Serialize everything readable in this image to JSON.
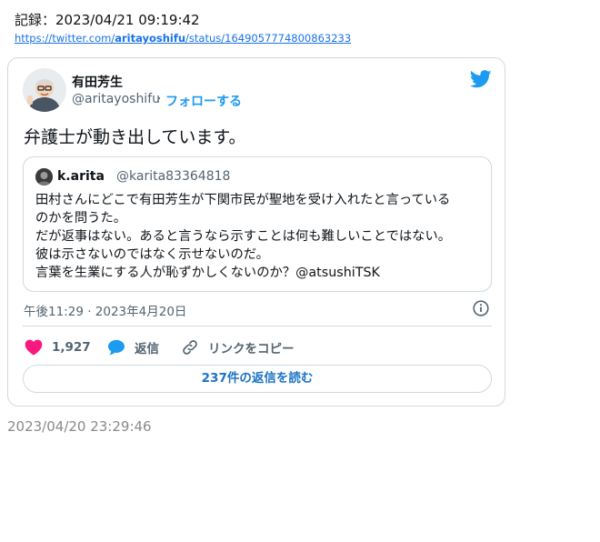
{
  "header": {
    "record_label": "記録：2023/04/21 09:19:42",
    "url_prefix": "https://twitter.com/",
    "url_user": "aritayoshifu",
    "url_suffix": "/status/1649057774800863233"
  },
  "tweet": {
    "author_name": "有田芳生",
    "author_handle": "@aritayoshifu",
    "separator": "·",
    "follow_label": "フォローする",
    "text": "弁護士が動き出しています。",
    "timestamp": "午後11:29 · 2023年4月20日",
    "like_count": "1,927",
    "reply_label": "返信",
    "copy_link_label": "リンクをコピー",
    "read_replies_label": "237件の返信を読む"
  },
  "quote": {
    "name": "k.arita",
    "handle": "@karita83364818",
    "lines": [
      "田村さんにどこで有田芳生が下関市民が聖地を受け入れたと言っている",
      "のかを問うた。",
      "だが返事はない。あると言うなら示すことは何も難しいことではない。",
      "彼は示さないのではなく示せないのだ。",
      "言葉を生業にする人が恥ずかしくないのか？@atsushiTSK"
    ]
  },
  "footer": {
    "captured_time": "2023/04/20 23:29:46"
  },
  "icons": {
    "brand": "twitter-bird-icon",
    "like": "heart-icon",
    "reply": "speech-bubble-icon",
    "copy": "link-icon",
    "info": "info-icon"
  },
  "colors": {
    "twitter_blue": "#1d9bf0",
    "like_pink": "#f91880",
    "secondary_text": "#536471",
    "border": "#cfd9de"
  }
}
